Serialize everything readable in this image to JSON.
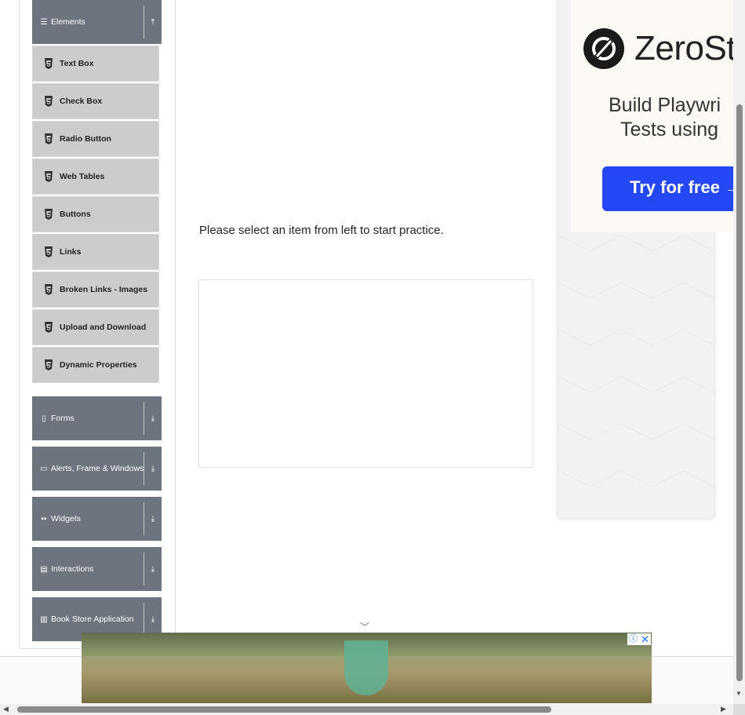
{
  "sidebar": {
    "elements_group": {
      "label": "Elements",
      "icon": "hamburger-icon",
      "arrow": "collapse-up-icon"
    },
    "items": [
      {
        "label": "Text Box"
      },
      {
        "label": "Check Box"
      },
      {
        "label": "Radio Button"
      },
      {
        "label": "Web Tables"
      },
      {
        "label": "Buttons"
      },
      {
        "label": "Links"
      },
      {
        "label": "Broken Links - Images"
      },
      {
        "label": "Upload and Download"
      },
      {
        "label": "Dynamic Properties"
      }
    ],
    "groups": [
      {
        "label": "Forms",
        "icon": "document-icon"
      },
      {
        "label": "Alerts, Frame & Windows",
        "icon": "window-icon"
      },
      {
        "label": "Widgets",
        "icon": "grid-icon"
      },
      {
        "label": "Interactions",
        "icon": "list-icon"
      },
      {
        "label": "Book Store Application",
        "icon": "books-icon"
      }
    ]
  },
  "main": {
    "prompt": "Please select an item from left to start practice."
  },
  "ad_right": {
    "brand": "ZeroSt",
    "headline_1": "Build Playwri",
    "headline_2": "Tests using",
    "cta": "Try for free →"
  },
  "ad_bottom": {
    "info": "ⓘ",
    "close": "✕"
  },
  "colors": {
    "group_header": "#6c757d",
    "menu_item": "#cccccc",
    "cta": "#2448f5"
  }
}
